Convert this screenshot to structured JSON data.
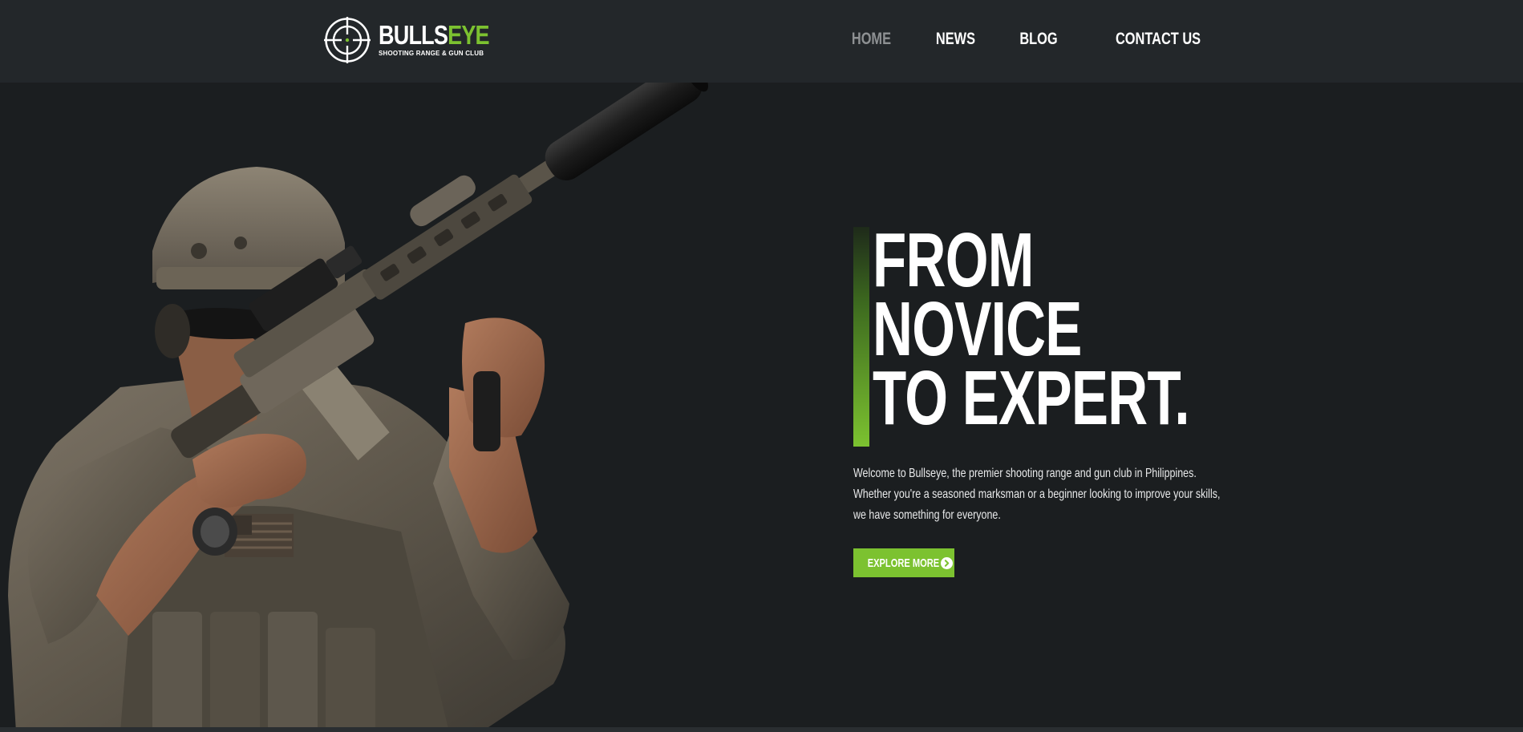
{
  "header": {
    "logo": {
      "word_main": "BULLS",
      "word_accent": "EYE",
      "tagline": "SHOOTING RANGE & GUN CLUB",
      "icon": "crosshair-icon"
    },
    "nav": [
      {
        "label": "HOME",
        "active": true
      },
      {
        "label": "NEWS",
        "active": false
      },
      {
        "label": "BLOG",
        "active": false
      },
      {
        "label": "CONTACT US",
        "active": false
      }
    ]
  },
  "hero": {
    "image": "soldier-aiming-rifle-image",
    "headline": [
      "FROM",
      "NOVICE",
      "TO EXPERT."
    ],
    "intro": "Welcome to Bullseye, the premier shooting range and gun club in Philippines. Whether you're a seasoned marksman or a beginner looking to improve your skills, we have something for everyone.",
    "cta_label": "EXPLORE MORE",
    "cta_icon": "arrow-right-circle-icon"
  },
  "colors": {
    "background": "#1b1e20",
    "header": "#23272a",
    "accent": "#7cc230",
    "nav_active": "#8e9193",
    "text": "#ffffff"
  }
}
